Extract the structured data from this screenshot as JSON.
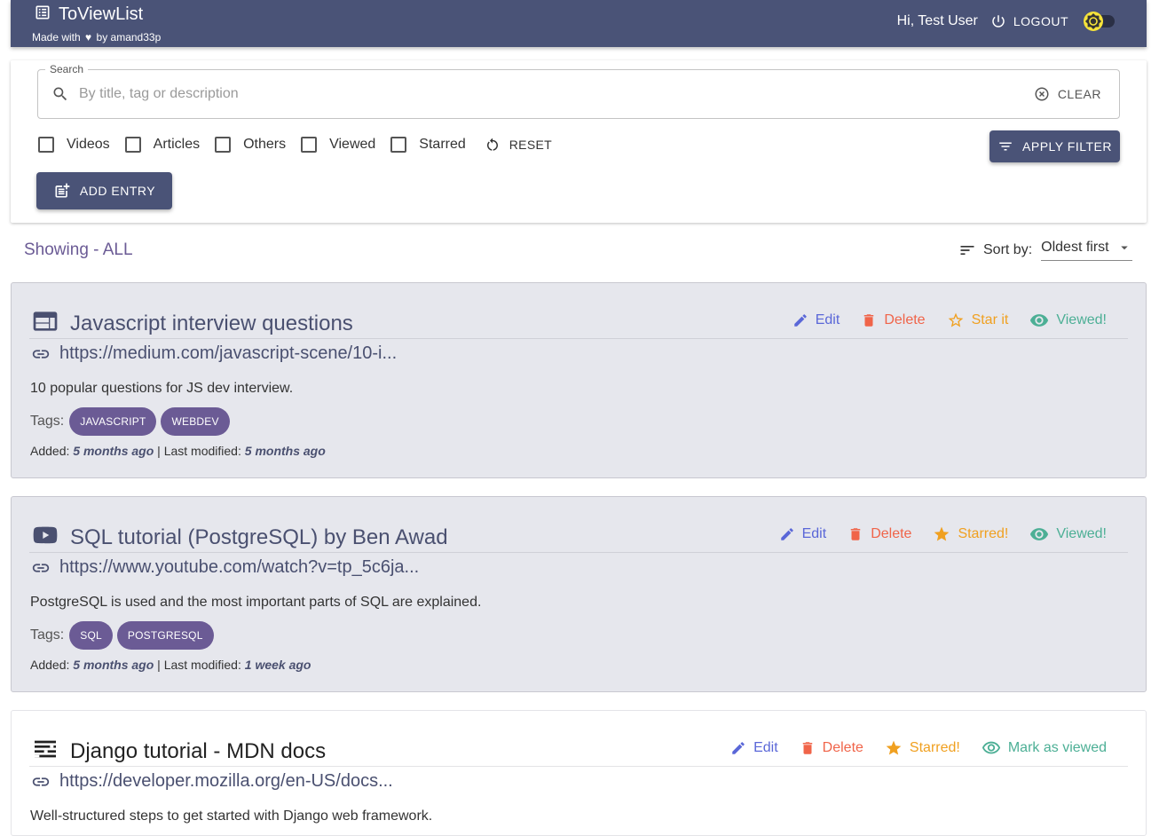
{
  "header": {
    "title": "ToViewList",
    "made_with": "Made with",
    "heart": "♥",
    "by": "by amand33p",
    "greeting": "Hi, Test User",
    "logout": "LOGOUT"
  },
  "search": {
    "legend": "Search",
    "placeholder": "By title, tag or description",
    "value": "",
    "clear": "CLEAR"
  },
  "filters": {
    "options": [
      "Videos",
      "Articles",
      "Others",
      "Viewed",
      "Starred"
    ],
    "reset": "RESET",
    "apply": "APPLY FILTER",
    "add_entry": "ADD ENTRY"
  },
  "list": {
    "showing": "Showing - ALL",
    "sort_label": "Sort by:",
    "sort_value": "Oldest first"
  },
  "entries": [
    {
      "icon": "article-icon",
      "title": "Javascript interview questions",
      "link": "https://medium.com/javascript-scene/10-i...",
      "description": "10 popular questions for JS dev interview.",
      "tags_label": "Tags:",
      "tags": [
        "JAVASCRIPT",
        "WEBDEV"
      ],
      "added_label": "Added:",
      "added": "5 months ago",
      "sep": "|",
      "modified_label": "Last modified:",
      "modified": "5 months ago",
      "edit": "Edit",
      "delete": "Delete",
      "star": "Star it",
      "view": "Viewed!",
      "starred": false,
      "viewed": true
    },
    {
      "icon": "video-icon",
      "title": "SQL tutorial (PostgreSQL) by Ben Awad",
      "link": "https://www.youtube.com/watch?v=tp_5c6ja...",
      "description": "PostgreSQL is used and the most important parts of SQL are explained.",
      "tags_label": "Tags:",
      "tags": [
        "SQL",
        "POSTGRESQL"
      ],
      "added_label": "Added:",
      "added": "5 months ago",
      "sep": "|",
      "modified_label": "Last modified:",
      "modified": "1 week ago",
      "edit": "Edit",
      "delete": "Delete",
      "star": "Starred!",
      "view": "Viewed!",
      "starred": true,
      "viewed": true
    },
    {
      "icon": "other-icon",
      "title": "Django tutorial - MDN docs",
      "link": "https://developer.mozilla.org/en-US/docs...",
      "description": "Well-structured steps to get started with Django web framework.",
      "edit": "Edit",
      "delete": "Delete",
      "star": "Starred!",
      "view": "Mark as viewed",
      "starred": true,
      "viewed": false
    }
  ],
  "colors": {
    "primary": "#4a5377",
    "tag": "#6b5b95",
    "edit": "#5a67d8",
    "delete": "#f06449",
    "star": "#f0a020",
    "view": "#4caf95",
    "card_viewed_bg": "#e6e7ed"
  }
}
